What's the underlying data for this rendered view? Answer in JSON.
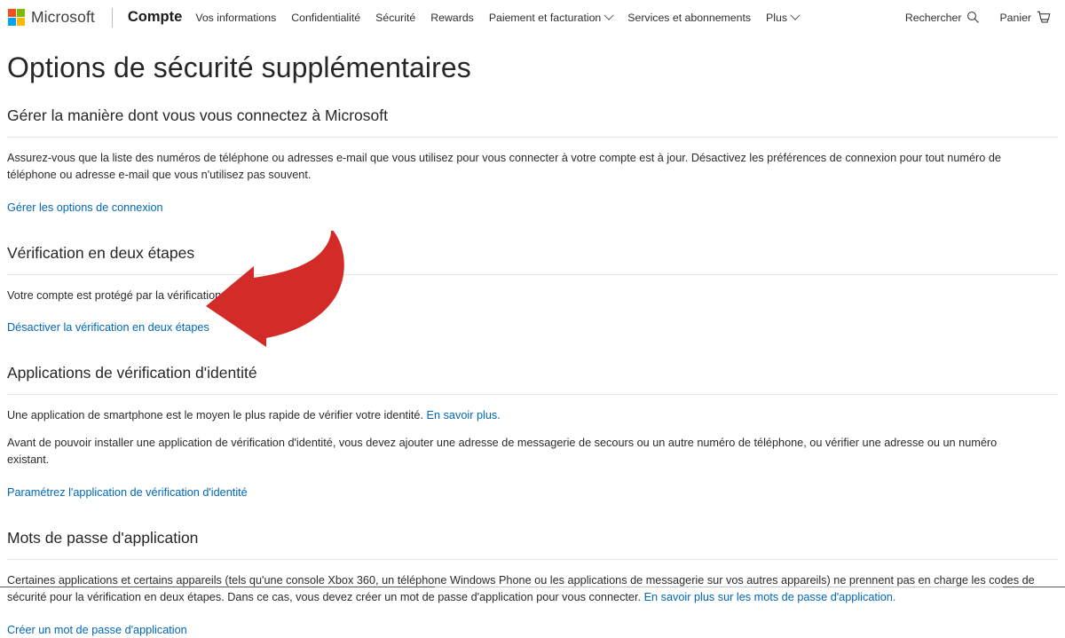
{
  "topnav": {
    "logo_text": "Microsoft",
    "logo_colors": {
      "top_left": "#f25022",
      "top_right": "#7fba00",
      "bottom_left": "#00a4ef",
      "bottom_right": "#ffb900"
    },
    "brand": "Compte",
    "links": [
      {
        "label": "Vos informations",
        "has_chevron": false
      },
      {
        "label": "Confidentialité",
        "has_chevron": false
      },
      {
        "label": "Sécurité",
        "has_chevron": false
      },
      {
        "label": "Rewards",
        "has_chevron": false
      },
      {
        "label": "Paiement et facturation",
        "has_chevron": true
      },
      {
        "label": "Services et abonnements",
        "has_chevron": false
      },
      {
        "label": "Plus",
        "has_chevron": true
      }
    ],
    "search_label": "Rechercher",
    "search_icon": "search-icon",
    "cart_label": "Panier",
    "cart_icon": "shopping-cart-icon"
  },
  "page": {
    "title": "Options de sécurité supplémentaires",
    "intro_heading": "Gérer la manière dont vous vous connectez à Microsoft",
    "intro_paragraph": "Assurez-vous que la liste des numéros de téléphone ou adresses e-mail que vous utilisez pour vous connecter à votre compte est à jour. Désactivez les préférences de connexion pour tout numéro de téléphone ou adresse e-mail que vous n'utilisez pas souvent.",
    "intro_link": "Gérer les options de connexion"
  },
  "two_step": {
    "heading": "Vérification en deux étapes",
    "status_text": "Votre compte est protégé par la vérification en deux étapes.",
    "action_link": "Désactiver la vérification en deux étapes"
  },
  "identity_apps": {
    "heading": "Applications de vérification d'identité",
    "paragraph_1_text": "Une application de smartphone est le moyen le plus rapide de vérifier votre identité. ",
    "paragraph_1_link": "En savoir plus.",
    "paragraph_2": "Avant de pouvoir installer une application de vérification d'identité, vous devez ajouter une adresse de messagerie de secours ou un autre numéro de téléphone, ou vérifier une adresse ou un numéro existant.",
    "action_link": "Paramétrez l'application de vérification d'identité"
  },
  "app_passwords": {
    "heading": "Mots de passe d'application",
    "paragraph_text": "Certaines applications et certains appareils (tels qu'une console Xbox 360, un téléphone Windows Phone ou les applications de messagerie sur vos autres appareils) ne prennent pas en charge les codes de sécurité pour la vérification en deux étapes. Dans ce cas, vous devez créer un mot de passe d'application pour vous connecter. ",
    "paragraph_link": "En savoir plus sur les mots de passe d'application.",
    "action_link": "Créer un mot de passe d'application"
  },
  "annotation": {
    "name": "red-curved-arrow",
    "color": "#d32b27",
    "points_at": "Désactiver la vérification en deux étapes"
  },
  "colors": {
    "link": "#0067b8",
    "text": "#262626",
    "rule": "#e3e3e3",
    "annotation_red": "#d32b27"
  }
}
